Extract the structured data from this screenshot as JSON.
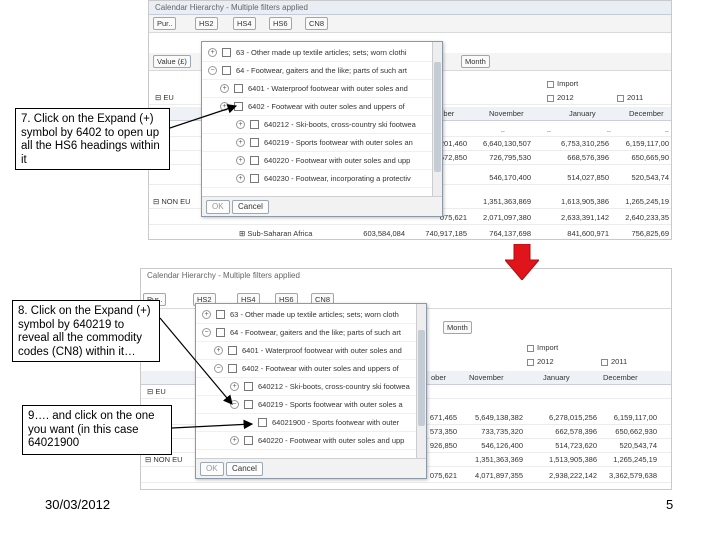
{
  "top_screenshot": {
    "title": "Calendar Hierarchy - Multiple filters applied",
    "toolbar1": [
      "Pur..",
      "HS2",
      "HS4",
      "HS6",
      "CN8"
    ],
    "toolbar2": [
      "Value (£)",
      "Month"
    ],
    "flow_items": [
      {
        "label": "Import",
        "checked": false
      },
      {
        "label": "2012",
        "checked": false
      },
      {
        "label": "2011",
        "checked": false
      }
    ],
    "grid_headers": [
      "ember",
      "November",
      "January",
      "December"
    ],
    "rows": [
      {
        "label": "EU",
        "values": [
          "..",
          "..",
          "..",
          ".."
        ]
      },
      {
        "label": "",
        "values": [
          "201,460",
          "6,640,130,507",
          "6,753,310,256",
          "6,159,117,00"
        ]
      },
      {
        "label": "",
        "values": [
          "572,850",
          "726,795,530",
          "668,576,396",
          "650,665,90"
        ]
      },
      {
        "label": "",
        "values": [
          "",
          "546,170,400",
          "514,027,850",
          "520,543,74"
        ]
      },
      {
        "label": "NON EU",
        "values": [
          "",
          "1,351,363,869",
          "1,613,905,386",
          "1,265,245,19"
        ]
      },
      {
        "label": "",
        "values": [
          "075,621",
          "2,071,097,380",
          "2,633,391,142",
          "2,640,233,35"
        ]
      },
      {
        "label": "Sub-Saharan Africa",
        "values": [
          "603,584,084",
          "740,917,185",
          "764,137,698",
          "841,600,971",
          "756,825,69"
        ]
      }
    ],
    "tree": [
      {
        "code": "63",
        "text": "- Other made up textile articles; sets; worn clothi",
        "expander": "+"
      },
      {
        "code": "64",
        "text": "- Footwear, gaiters and the like; parts of such art",
        "expander": "−"
      },
      {
        "code": "6401",
        "text": "- Waterproof footwear with outer soles and",
        "expander": "+"
      },
      {
        "code": "6402",
        "text": "- Footwear with outer soles and uppers of",
        "expander": "+"
      },
      {
        "code": "640212",
        "text": "- Ski-boots, cross-country ski footwea",
        "expander": "+"
      },
      {
        "code": "640219",
        "text": "- Sports footwear with outer soles an",
        "expander": "+"
      },
      {
        "code": "640220",
        "text": "- Footwear with outer soles and upp",
        "expander": "+"
      },
      {
        "code": "640230",
        "text": "- Footwear, incorporating a protectiv",
        "expander": "+"
      }
    ],
    "ok_label": "OK",
    "cancel_label": "Cancel"
  },
  "bottom_screenshot": {
    "title": "Calendar Hierarchy - Multiple filters applied",
    "toolbar1": [
      "Pur..",
      "HS2",
      "HS4",
      "HS6",
      "CN8"
    ],
    "toolbar2": [
      "Month"
    ],
    "flow_items": [
      {
        "label": "Import",
        "checked": false
      },
      {
        "label": "2012",
        "checked": false
      },
      {
        "label": "2011",
        "checked": false
      }
    ],
    "grid_headers": [
      "ober",
      "November",
      "January",
      "December"
    ],
    "rows": [
      {
        "label": "EU",
        "values": [
          "",
          "",
          "",
          ""
        ]
      },
      {
        "label": "",
        "values": [
          "671,465",
          "5,649,138,382",
          "6,278,015,256",
          "6,159,117,00"
        ]
      },
      {
        "label": "",
        "values": [
          "573,350",
          "733,735,320",
          "662,578,396",
          "650,662,930"
        ]
      },
      {
        "label": "",
        "values": [
          "926,850",
          "546,126,400",
          "514,723,620",
          "520,543,74"
        ]
      },
      {
        "label": "NON EU",
        "values": [
          "",
          "1,351,363,369",
          "1,513,905,386",
          "1,265,245,19"
        ]
      },
      {
        "label": "",
        "values": [
          "075,621",
          "4,071,897,355",
          "2,938,222,142",
          "3,362,579,638"
        ]
      }
    ],
    "tree": [
      {
        "code": "63",
        "text": "- Other made up textile articles; sets; worn cloth",
        "expander": "+"
      },
      {
        "code": "64",
        "text": "- Footwear, gaiters and the like; parts of such art",
        "expander": "−"
      },
      {
        "code": "6401",
        "text": "- Waterproof footwear with outer soles and",
        "expander": "+"
      },
      {
        "code": "6402",
        "text": "- Footwear with outer soles and uppers of",
        "expander": "−"
      },
      {
        "code": "640212",
        "text": "- Ski-boots, cross-country ski footwea",
        "expander": "+"
      },
      {
        "code": "640219",
        "text": "- Sports footwear with outer soles a",
        "expander": "−"
      },
      {
        "code": "64021900",
        "text": "- Sports footwear with outer",
        "expander": ""
      },
      {
        "code": "640220",
        "text": "- Footwear with outer soles and upp",
        "expander": "+"
      }
    ],
    "ok_label": "OK",
    "cancel_label": "Cancel"
  },
  "callouts": {
    "step7": "7. Click on the Expand (+) symbol by 6402 to open up all the HS6 headings within it",
    "step8": "8. Click on the Expand (+) symbol by 640219 to reveal all the commodity codes (CN8) within it…",
    "step9": "9…. and click on the one you want (in this case 64021900"
  },
  "footer": {
    "date": "30/03/2012",
    "page": "5"
  },
  "colors": {
    "arrow_red": "#e0141b",
    "panel_header": "#e9eef5"
  }
}
